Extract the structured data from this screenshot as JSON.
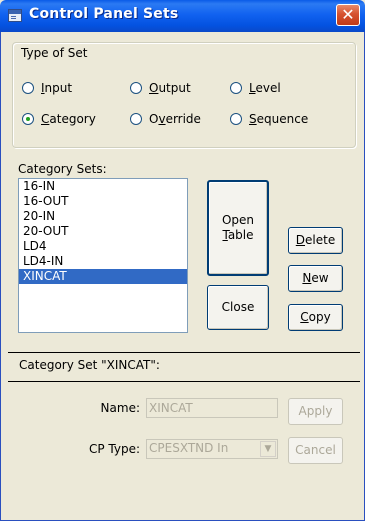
{
  "window": {
    "title": "Control Panel Sets",
    "close_glyph": "✕"
  },
  "type_of_set": {
    "legend": "Type of Set",
    "options": [
      {
        "pre": "",
        "key": "I",
        "post": "nput",
        "selected": false
      },
      {
        "pre": "",
        "key": "O",
        "post": "utput",
        "selected": false
      },
      {
        "pre": "",
        "key": "L",
        "post": "evel",
        "selected": false
      },
      {
        "pre": "",
        "key": "C",
        "post": "ategory",
        "selected": true
      },
      {
        "pre": "O",
        "key": "v",
        "post": "erride",
        "selected": false
      },
      {
        "pre": "",
        "key": "S",
        "post": "equence",
        "selected": false
      }
    ]
  },
  "category_sets": {
    "label": "Category Sets:",
    "items": [
      "16-IN",
      "16-OUT",
      "20-IN",
      "20-OUT",
      "LD4",
      "LD4-IN",
      "XINCAT"
    ],
    "selected": "XINCAT"
  },
  "buttons": {
    "open_table": {
      "line1": "Open",
      "line2_key": "T",
      "line2_rest": "able"
    },
    "delete": {
      "key": "D",
      "rest": "elete"
    },
    "new": {
      "key": "N",
      "rest": "ew"
    },
    "close": {
      "label": "Close"
    },
    "copy": {
      "key": "C",
      "rest": "opy"
    },
    "apply": {
      "label": "Apply"
    },
    "cancel": {
      "label": "Cancel"
    }
  },
  "details": {
    "title": "Category Set \"XINCAT\":",
    "name_label": "Name:",
    "name_value": "XINCAT",
    "cp_type_label": "CP Type:",
    "cp_type_value": "CPESXTND In"
  },
  "icons": {
    "dropdown": "▼"
  }
}
